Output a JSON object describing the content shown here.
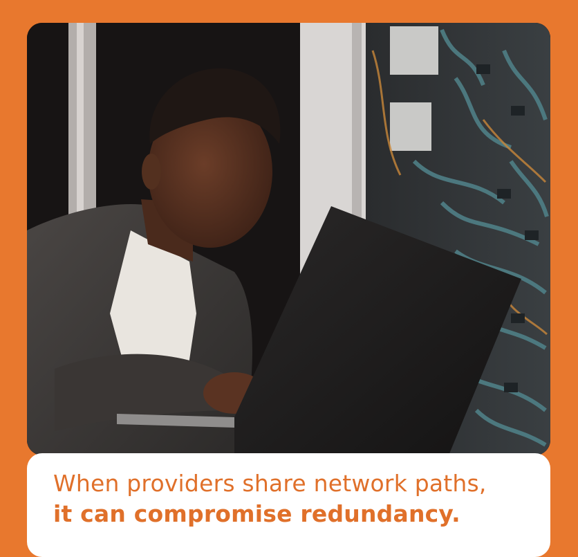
{
  "caption": {
    "line1": "When providers share network paths,",
    "line2": "it can compromise redundancy."
  },
  "colors": {
    "frame": "#e8782e",
    "caption_text": "#e0702a",
    "card": "#ffffff"
  },
  "photo": {
    "scene": "person-typing-on-laptop-near-server-rack"
  }
}
